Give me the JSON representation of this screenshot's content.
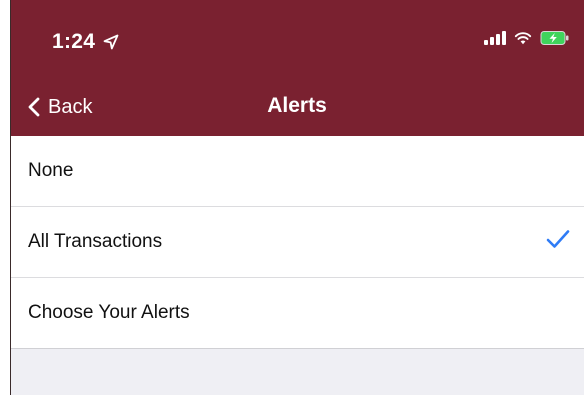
{
  "status_bar": {
    "time": "1:24"
  },
  "nav": {
    "back_label": "Back",
    "title": "Alerts"
  },
  "alert_options": [
    {
      "label": "None",
      "selected": false
    },
    {
      "label": "All Transactions",
      "selected": true
    },
    {
      "label": "Choose Your Alerts",
      "selected": false
    }
  ],
  "colors": {
    "header_bg": "#7a2130",
    "checkmark": "#2f7cf6",
    "grouped_bg": "#efeff4"
  },
  "icons": {
    "location": "location-arrow-icon",
    "signal": "cellular-signal-icon",
    "wifi": "wifi-icon",
    "battery": "battery-charging-icon",
    "back": "chevron-left-icon",
    "check": "checkmark-icon"
  }
}
